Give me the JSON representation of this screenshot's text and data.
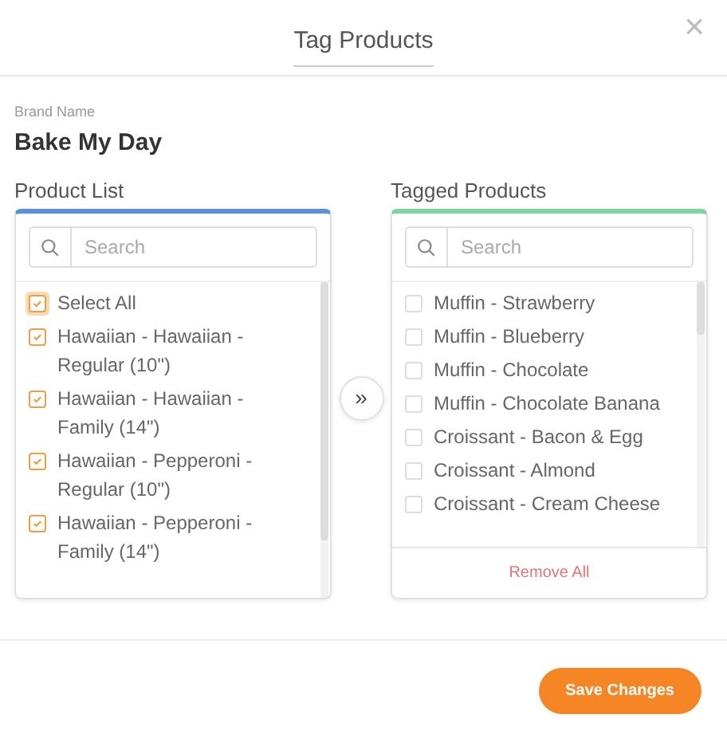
{
  "dialog": {
    "title": "Tag Products",
    "close": "×"
  },
  "brand": {
    "label": "Brand Name",
    "value": "Bake My Day"
  },
  "product_list": {
    "heading": "Product List",
    "search": {
      "placeholder": "Search"
    },
    "items": [
      {
        "label": "Select All",
        "checked": true,
        "focused": true
      },
      {
        "label": "Hawaiian - Hawaiian - Regular (10\")",
        "checked": true,
        "focused": false
      },
      {
        "label": "Hawaiian - Hawaiian - Family (14\")",
        "checked": true,
        "focused": false
      },
      {
        "label": "Hawaiian - Pepperoni - Regular (10\")",
        "checked": true,
        "focused": false
      },
      {
        "label": "Hawaiian - Pepperoni - Family (14\")",
        "checked": true,
        "focused": false
      }
    ]
  },
  "move_button": "»",
  "tagged_products": {
    "heading": "Tagged Products",
    "search": {
      "placeholder": "Search"
    },
    "items": [
      {
        "label": "Muffin - Strawberry",
        "checked": false
      },
      {
        "label": "Muffin - Blueberry",
        "checked": false
      },
      {
        "label": "Muffin - Chocolate",
        "checked": false
      },
      {
        "label": "Muffin - Chocolate Banana",
        "checked": false
      },
      {
        "label": "Croissant - Bacon & Egg",
        "checked": false
      },
      {
        "label": "Croissant - Almond",
        "checked": false
      },
      {
        "label": "Croissant - Cream Cheese",
        "checked": false
      }
    ],
    "remove_all": "Remove All"
  },
  "save_button": "Save Changes"
}
